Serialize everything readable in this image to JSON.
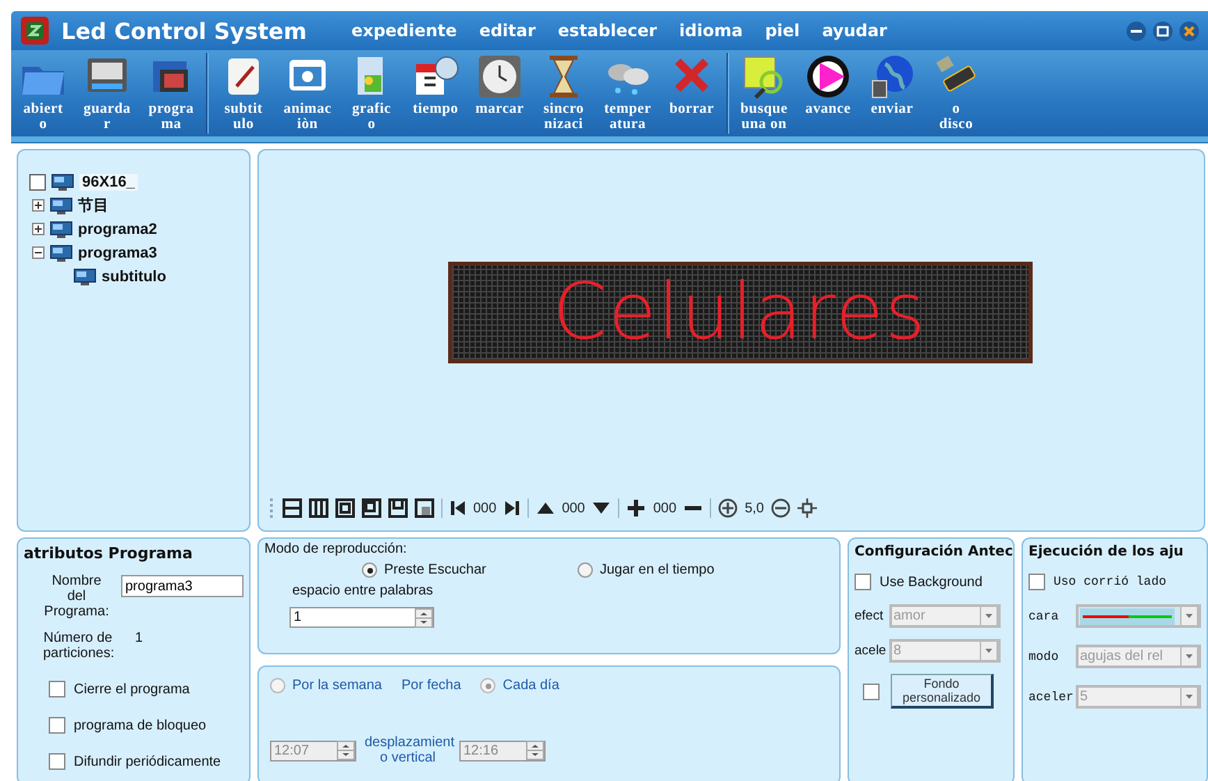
{
  "window": {
    "title": "Led Control System"
  },
  "menu": [
    "expediente",
    "editar",
    "establecer",
    "idioma",
    "piel",
    "ayudar"
  ],
  "toolbar": [
    [
      {
        "label": "abiert\no"
      },
      {
        "label": "guarda\nr"
      },
      {
        "label": "progra\nma"
      }
    ],
    [
      {
        "label": "subtit\nulo"
      },
      {
        "label": "animac\niòn"
      },
      {
        "label": "grafic\no"
      },
      {
        "label": "tiempo"
      },
      {
        "label": "marcar"
      },
      {
        "label": "sincro\nnizaci"
      },
      {
        "label": "temper\natura"
      },
      {
        "label": "borrar"
      }
    ],
    [
      {
        "label": "busque\nuna on"
      },
      {
        "label": "avance"
      },
      {
        "label": "enviar"
      },
      {
        "label": "o\ndisco"
      }
    ]
  ],
  "tree": {
    "label": "96X16_",
    "checked": false,
    "selected": true,
    "children": [
      {
        "label": "节目",
        "expanded": false,
        "selected": false
      },
      {
        "label": "programa2",
        "expanded": false,
        "selected": false
      },
      {
        "label": "programa3",
        "expanded": true,
        "selected": false,
        "children": [
          {
            "label": "subtitulo",
            "selected": false
          }
        ]
      }
    ]
  },
  "preview": {
    "display_text": "Celulares",
    "toolbar_readings": [
      "000",
      "000",
      "000",
      "5,0"
    ]
  },
  "attributes": {
    "title": "atributos Programa",
    "name_label": "Nombre del Programa:",
    "name_value": "programa3",
    "partitions_label": "Número de particiones:",
    "partitions_value": "1",
    "options": [
      {
        "label": "Cierre el programa",
        "checked": false
      },
      {
        "label": "programa de bloqueo",
        "checked": false
      },
      {
        "label": "Difundir periódicamente",
        "checked": false
      }
    ]
  },
  "playback": {
    "title": "Modo de reproducción:",
    "modes": [
      {
        "label": "Preste Escuchar",
        "selected": true
      },
      {
        "label": "Jugar en el tiempo",
        "selected": false
      }
    ],
    "spacing_label": "espacio entre palabras",
    "spacing_value": "1"
  },
  "schedule": {
    "modes": [
      {
        "label": "Por la semana",
        "selected": false
      },
      {
        "label": "Cada día",
        "selected": true
      }
    ],
    "date_label": "Por fecha",
    "start": {
      "value": "12:07",
      "disabled": true
    },
    "offset_label": "desplazamient o vertical",
    "end": {
      "value": "12:16",
      "disabled": true
    }
  },
  "background": {
    "title": "Configuración Antec",
    "use_background": {
      "label": "Use Background",
      "checked": false
    },
    "effect_label": "efect",
    "effect_value": "amor",
    "speed_label": "acele",
    "speed_value": "8",
    "custom": {
      "checked": false,
      "button": "Fondo personalizado"
    }
  },
  "execution": {
    "title": "Ejecución de los aju",
    "side": {
      "label": "Uso corrió lado",
      "checked": false
    },
    "face_label": "cara",
    "mode_label": "modo",
    "mode_value": "agujas del rel",
    "speed_label": "aceler",
    "speed_value": "5"
  }
}
